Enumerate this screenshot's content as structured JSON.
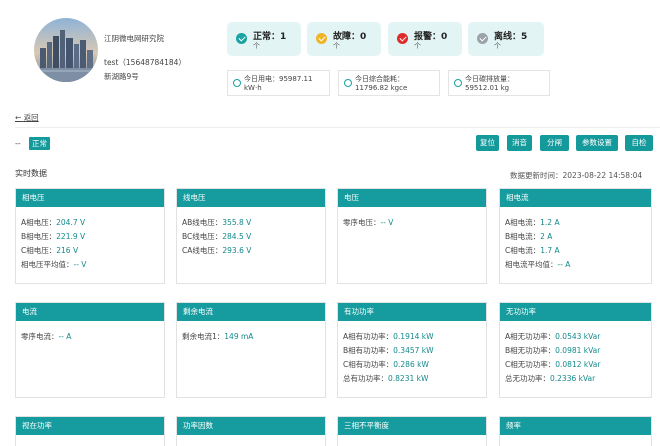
{
  "header": {
    "org_name": "江阴微电网研究院",
    "user_name": "test（15648784184）",
    "address": "新湖路9号"
  },
  "status_summary": [
    {
      "label": "正常：1",
      "unit": "个",
      "color": "#1aa3a3",
      "icon": "check-circle-icon"
    },
    {
      "label": "故障：0",
      "unit": "个",
      "color": "#f0b429",
      "icon": "warning-circle-icon"
    },
    {
      "label": "报警：0",
      "unit": "个",
      "color": "#e02b2b",
      "icon": "alert-circle-icon"
    },
    {
      "label": "离线：5",
      "unit": "个",
      "color": "#9aa3a8",
      "icon": "offline-circle-icon"
    }
  ],
  "stats": [
    {
      "line1": "今日用电：95987.11",
      "line2": "kW·h"
    },
    {
      "line1": "今日综合能耗：",
      "line2": "11796.82 kgce"
    },
    {
      "line1": "今日碳排放量：",
      "line2": "59512.01 kg"
    }
  ],
  "nav": {
    "back_label": "返回"
  },
  "device": {
    "status_prefix": "--",
    "status": "正常"
  },
  "actions": [
    "复位",
    "消音",
    "分闸",
    "参数设置",
    "自检"
  ],
  "section": {
    "title": "实时数据",
    "update_time": "数据更新时间：2023-08-22 14:58:04"
  },
  "cards": [
    {
      "title": "相电压",
      "rows": [
        {
          "label": "A相电压：",
          "value": "204.7 V"
        },
        {
          "label": "B相电压：",
          "value": "221.9 V"
        },
        {
          "label": "C相电压：",
          "value": "216 V"
        },
        {
          "label": "相电压平均值：",
          "value": "-- V"
        }
      ]
    },
    {
      "title": "线电压",
      "rows": [
        {
          "label": "AB线电压：",
          "value": "355.8 V"
        },
        {
          "label": "BC线电压：",
          "value": "284.5 V"
        },
        {
          "label": "CA线电压：",
          "value": "293.6 V"
        }
      ]
    },
    {
      "title": "电压",
      "rows": [
        {
          "label": "零序电压：",
          "value": "-- V"
        }
      ]
    },
    {
      "title": "相电流",
      "rows": [
        {
          "label": "A相电流：",
          "value": "1.2 A"
        },
        {
          "label": "B相电流：",
          "value": "2 A"
        },
        {
          "label": "C相电流：",
          "value": "1.7 A"
        },
        {
          "label": "相电流平均值：",
          "value": "-- A"
        }
      ]
    },
    {
      "title": "电流",
      "rows": [
        {
          "label": "零序电流：",
          "value": "-- A"
        }
      ]
    },
    {
      "title": "剩余电流",
      "rows": [
        {
          "label": "剩余电流1：",
          "value": "149 mA"
        }
      ]
    },
    {
      "title": "有功功率",
      "rows": [
        {
          "label": "A相有功功率：",
          "value": "0.1914 kW"
        },
        {
          "label": "B相有功功率：",
          "value": "0.3457 kW"
        },
        {
          "label": "C相有功功率：",
          "value": "0.286 kW"
        },
        {
          "label": "总有功功率：",
          "value": "0.8231 kW"
        }
      ]
    },
    {
      "title": "无功功率",
      "rows": [
        {
          "label": "A相无功功率：",
          "value": "0.0543 kVar"
        },
        {
          "label": "B相无功功率：",
          "value": "0.0981 kVar"
        },
        {
          "label": "C相无功功率：",
          "value": "0.0812 kVar"
        },
        {
          "label": "总无功功率：",
          "value": "0.2336 kVar"
        }
      ]
    },
    {
      "title": "视在功率",
      "rows": []
    },
    {
      "title": "功率因数",
      "rows": []
    },
    {
      "title": "三相不平衡度",
      "rows": []
    },
    {
      "title": "频率",
      "rows": []
    }
  ]
}
